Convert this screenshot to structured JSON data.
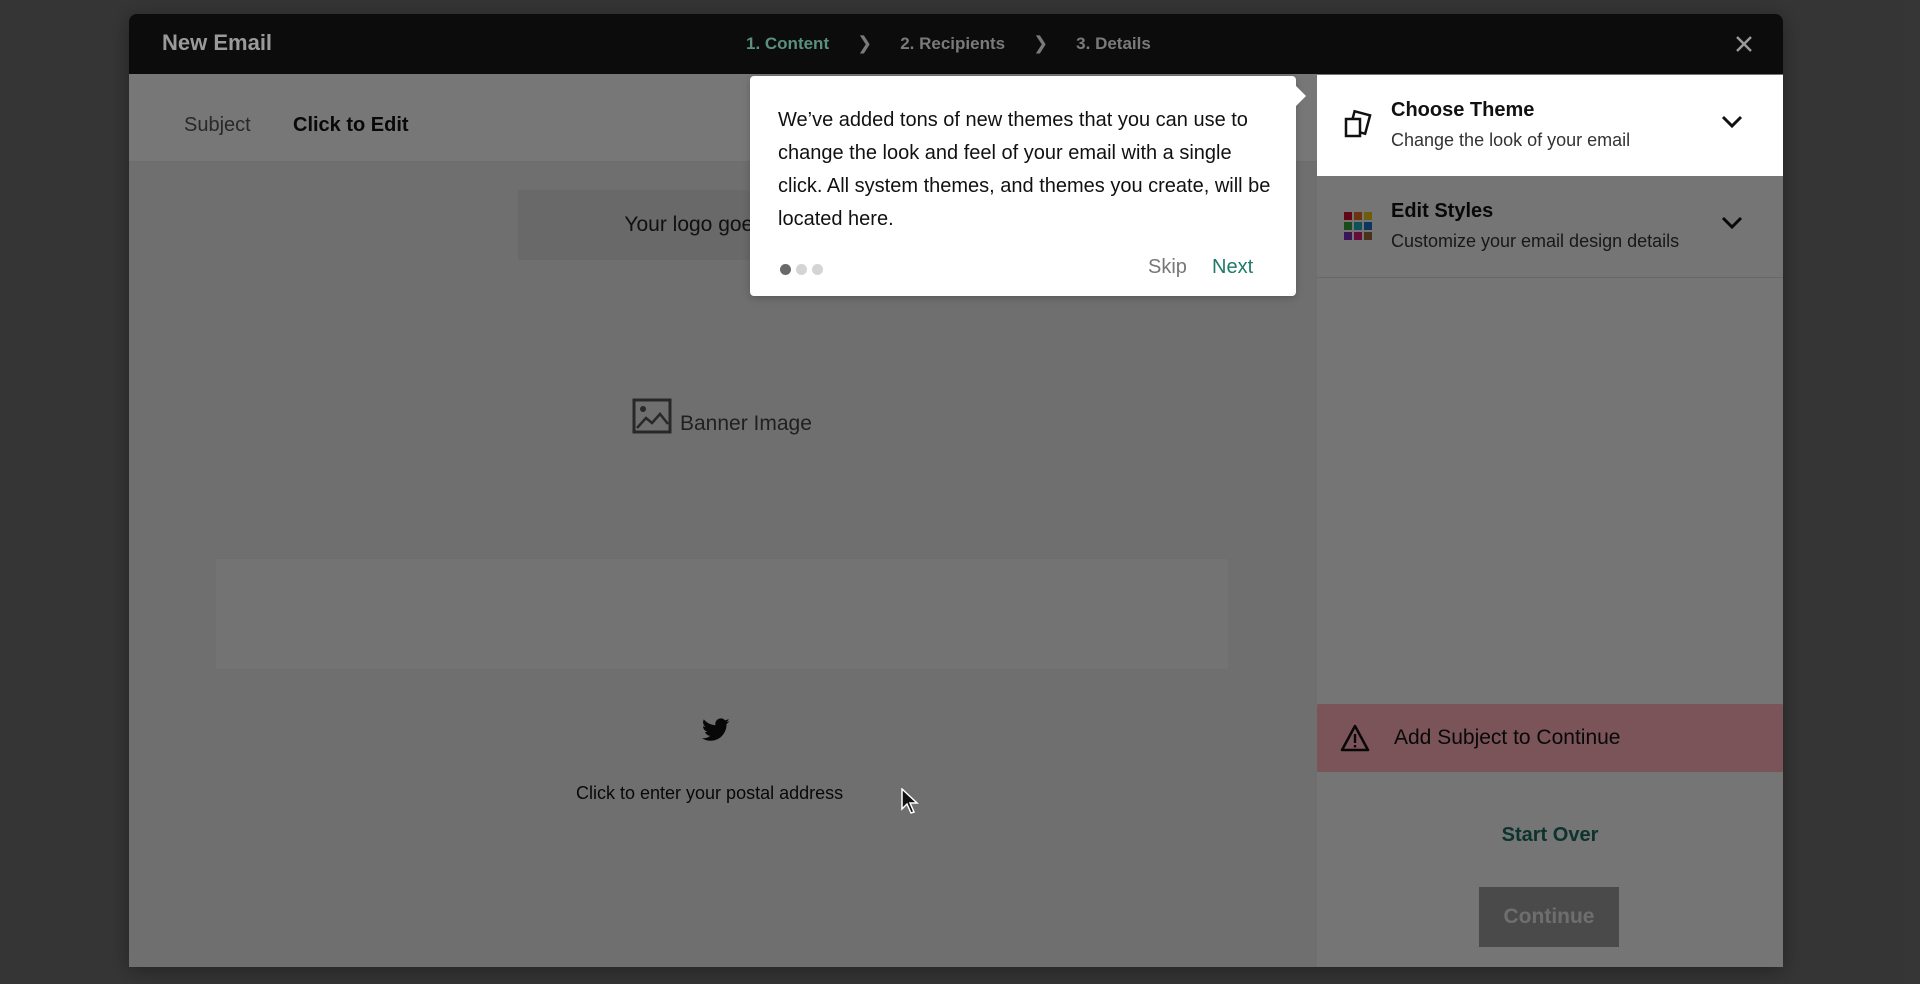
{
  "header": {
    "title": "New Email",
    "steps": [
      {
        "label": "1. Content",
        "active": true
      },
      {
        "label": "2. Recipients",
        "active": false
      },
      {
        "label": "3. Details",
        "active": false
      }
    ],
    "close_icon": "close-icon"
  },
  "subject": {
    "label": "Subject",
    "value": "Click to Edit"
  },
  "canvas": {
    "logo_placeholder": "Your logo goes here",
    "banner_label": "Banner Image",
    "social_icon": "twitter-icon",
    "postal_address": "Click to enter your postal address"
  },
  "sidebar": {
    "items": [
      {
        "title": "Choose Theme",
        "subtitle": "Change the look of your email",
        "icon": "theme-cards-icon"
      },
      {
        "title": "Edit Styles",
        "subtitle": "Customize your email design details",
        "icon": "color-grid-icon"
      }
    ],
    "alert": "Add Subject to Continue",
    "start_over": "Start Over",
    "continue": "Continue"
  },
  "popover": {
    "text": "We’ve added tons of new themes that you can use to change the look and feel of your email with a single click. All system themes, and themes you create, will be located here.",
    "step_current": 1,
    "step_total": 3,
    "skip": "Skip",
    "next": "Next"
  },
  "colors": {
    "accent": "#1f7a6a",
    "active_step": "#3d9b8a",
    "alert_bg": "#ffb0b8",
    "header_bg": "#111111",
    "palette": [
      "#c8102e",
      "#e86a24",
      "#e3c21a",
      "#3a9d3a",
      "#1eaab8",
      "#1f6fc2",
      "#7a2fb8",
      "#d41a78",
      "#9a6a3a"
    ]
  }
}
